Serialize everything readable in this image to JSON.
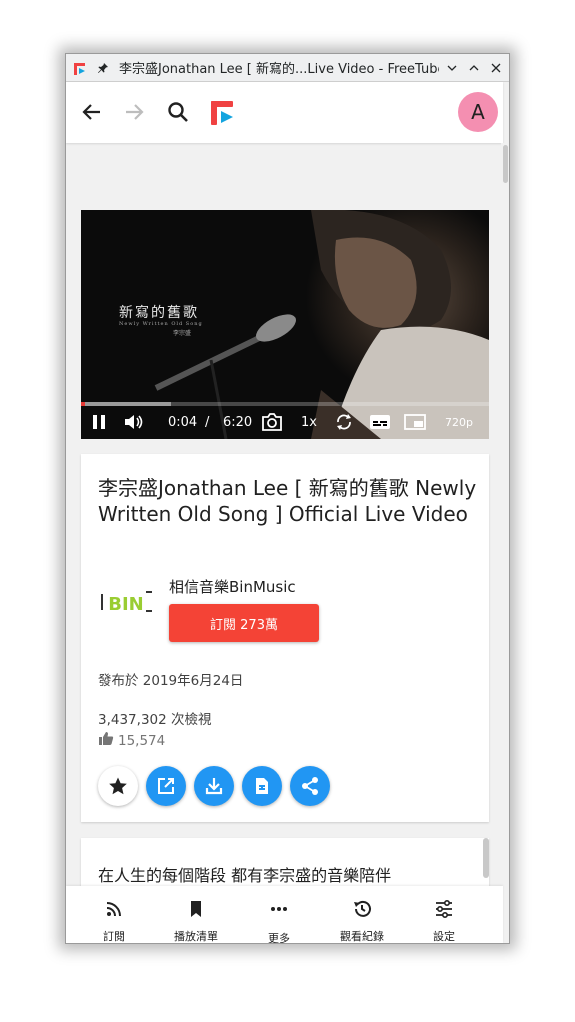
{
  "window": {
    "title": "李宗盛Jonathan Lee [ 新寫的...Live Video - FreeTube"
  },
  "topnav": {
    "back_icon": "arrow-left-icon",
    "forward_icon": "arrow-right-icon",
    "search_icon": "search-icon",
    "avatar_letter": "A"
  },
  "player": {
    "overlay_title": "新寫的舊歌",
    "overlay_subtitle": "Newly Written Old Song",
    "overlay_artist": "李宗盛",
    "current_time": "0:04",
    "separator": "/",
    "duration": "6:20",
    "speed": "1x",
    "quality": "720p",
    "progress_fraction": 0.0105,
    "buffer_fraction": 0.22,
    "colors": {
      "progress": "#e53935"
    }
  },
  "video": {
    "title": "李宗盛Jonathan Lee [ 新寫的舊歌 Newly Written Old Song ] Official Live Video",
    "channel_name": "相信音樂BinMusic",
    "channel_logo_text": "BIN",
    "subscribe_label": "訂閱 273萬",
    "published": "發布於 2019年6月24日",
    "views": "3,437,302 次檢視",
    "likes": "15,574",
    "actions": [
      "star-icon",
      "external-link-icon",
      "download-icon",
      "file-icon",
      "share-icon"
    ],
    "colors": {
      "subscribe": "#f44336",
      "action": "#2196f3",
      "avatar": "#f48fb1"
    }
  },
  "description": {
    "text": "在人生的每個階段 都有李宗盛的音樂陪伴"
  },
  "bottomnav": {
    "items": [
      {
        "label": "訂閱",
        "icon": "rss-icon"
      },
      {
        "label": "播放清單",
        "icon": "bookmark-icon"
      },
      {
        "label": "更多",
        "icon": "more-icon"
      },
      {
        "label": "觀看紀錄",
        "icon": "history-icon"
      },
      {
        "label": "設定",
        "icon": "sliders-icon"
      }
    ]
  }
}
